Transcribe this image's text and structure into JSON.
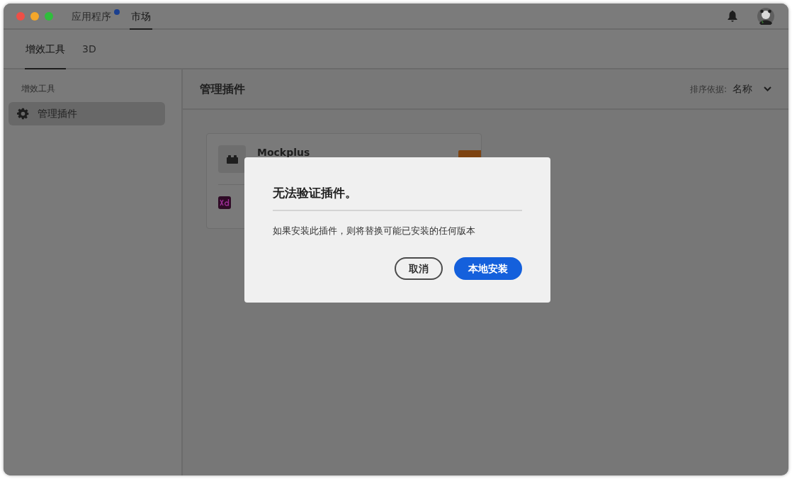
{
  "window": {
    "tabs": [
      {
        "label": "应用程序",
        "selected": false,
        "notification": true
      },
      {
        "label": "市场",
        "selected": true,
        "notification": false
      }
    ]
  },
  "sub_tabs": [
    {
      "label": "增效工具",
      "selected": true
    },
    {
      "label": "3D",
      "selected": false
    }
  ],
  "sidebar": {
    "heading": "增效工具",
    "items": [
      {
        "label": "管理插件",
        "selected": true
      }
    ]
  },
  "main": {
    "title": "管理插件",
    "sort": {
      "label": "排序依据:",
      "value": "名称"
    },
    "plugins": [
      {
        "name": "Mockplus"
      }
    ]
  },
  "dialog": {
    "title": "无法验证插件。",
    "message": "如果安装此插件，则将替换可能已安装的任何版本",
    "buttons": [
      {
        "label": "取消",
        "kind": "secondary"
      },
      {
        "label": "本地安装",
        "kind": "primary"
      }
    ]
  }
}
